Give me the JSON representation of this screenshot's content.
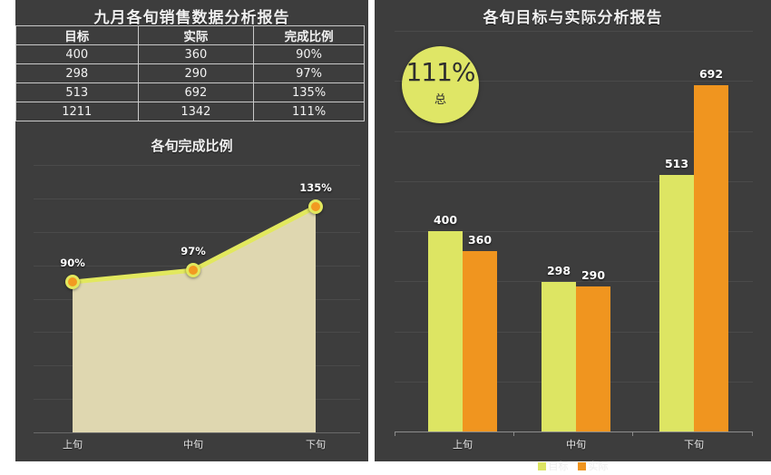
{
  "left_panel": {
    "title": "九月各旬销售数据分析报告",
    "table": {
      "headers": [
        "目标",
        "实际",
        "完成比例"
      ],
      "rows": [
        [
          "400",
          "360",
          "90%"
        ],
        [
          "298",
          "290",
          "97%"
        ],
        [
          "513",
          "692",
          "135%"
        ],
        [
          "1211",
          "1342",
          "111%"
        ]
      ]
    },
    "chart_title": "各旬完成比例"
  },
  "right_panel": {
    "title": "各旬目标与实际分析报告",
    "badge": {
      "value": "111%",
      "caption": "总"
    },
    "legend": [
      {
        "label": "目标",
        "color": "#dde563"
      },
      {
        "label": "实际",
        "color": "#f0951f"
      }
    ]
  },
  "colors": {
    "background": "#3d3d3d",
    "target_yellow": "#dde563",
    "actual_orange": "#f0951f",
    "area_fill": "#dfd7b0",
    "line_yellow": "#e2e85e",
    "marker_orange": "#f29a21",
    "gridline": "#4a4a4a",
    "text": "#f0f0f0"
  },
  "chart_data": [
    {
      "type": "line",
      "title": "各旬完成比例",
      "categories": [
        "上旬",
        "中旬",
        "下旬"
      ],
      "values": [
        90,
        97,
        135
      ],
      "point_labels": [
        "90%",
        "97%",
        "135%"
      ],
      "xlabel": "",
      "ylabel": "",
      "ylim": [
        0,
        160
      ],
      "grid": true,
      "legend": "none",
      "area_fill": true,
      "series_name": "完成比例"
    },
    {
      "type": "bar",
      "title": "各旬目标与实际分析报告",
      "categories": [
        "上旬",
        "中旬",
        "下旬"
      ],
      "series": [
        {
          "name": "目标",
          "values": [
            400,
            298,
            513
          ],
          "color": "#dde563"
        },
        {
          "name": "实际",
          "values": [
            360,
            290,
            692
          ],
          "color": "#f0951f"
        }
      ],
      "data_labels": [
        [
          "400",
          "360"
        ],
        [
          "298",
          "290"
        ],
        [
          "513",
          "692"
        ]
      ],
      "xlabel": "",
      "ylabel": "",
      "ylim": [
        0,
        800
      ],
      "grid": true,
      "legend": "bottom",
      "annotation": {
        "value": "111%",
        "caption": "总"
      }
    }
  ]
}
